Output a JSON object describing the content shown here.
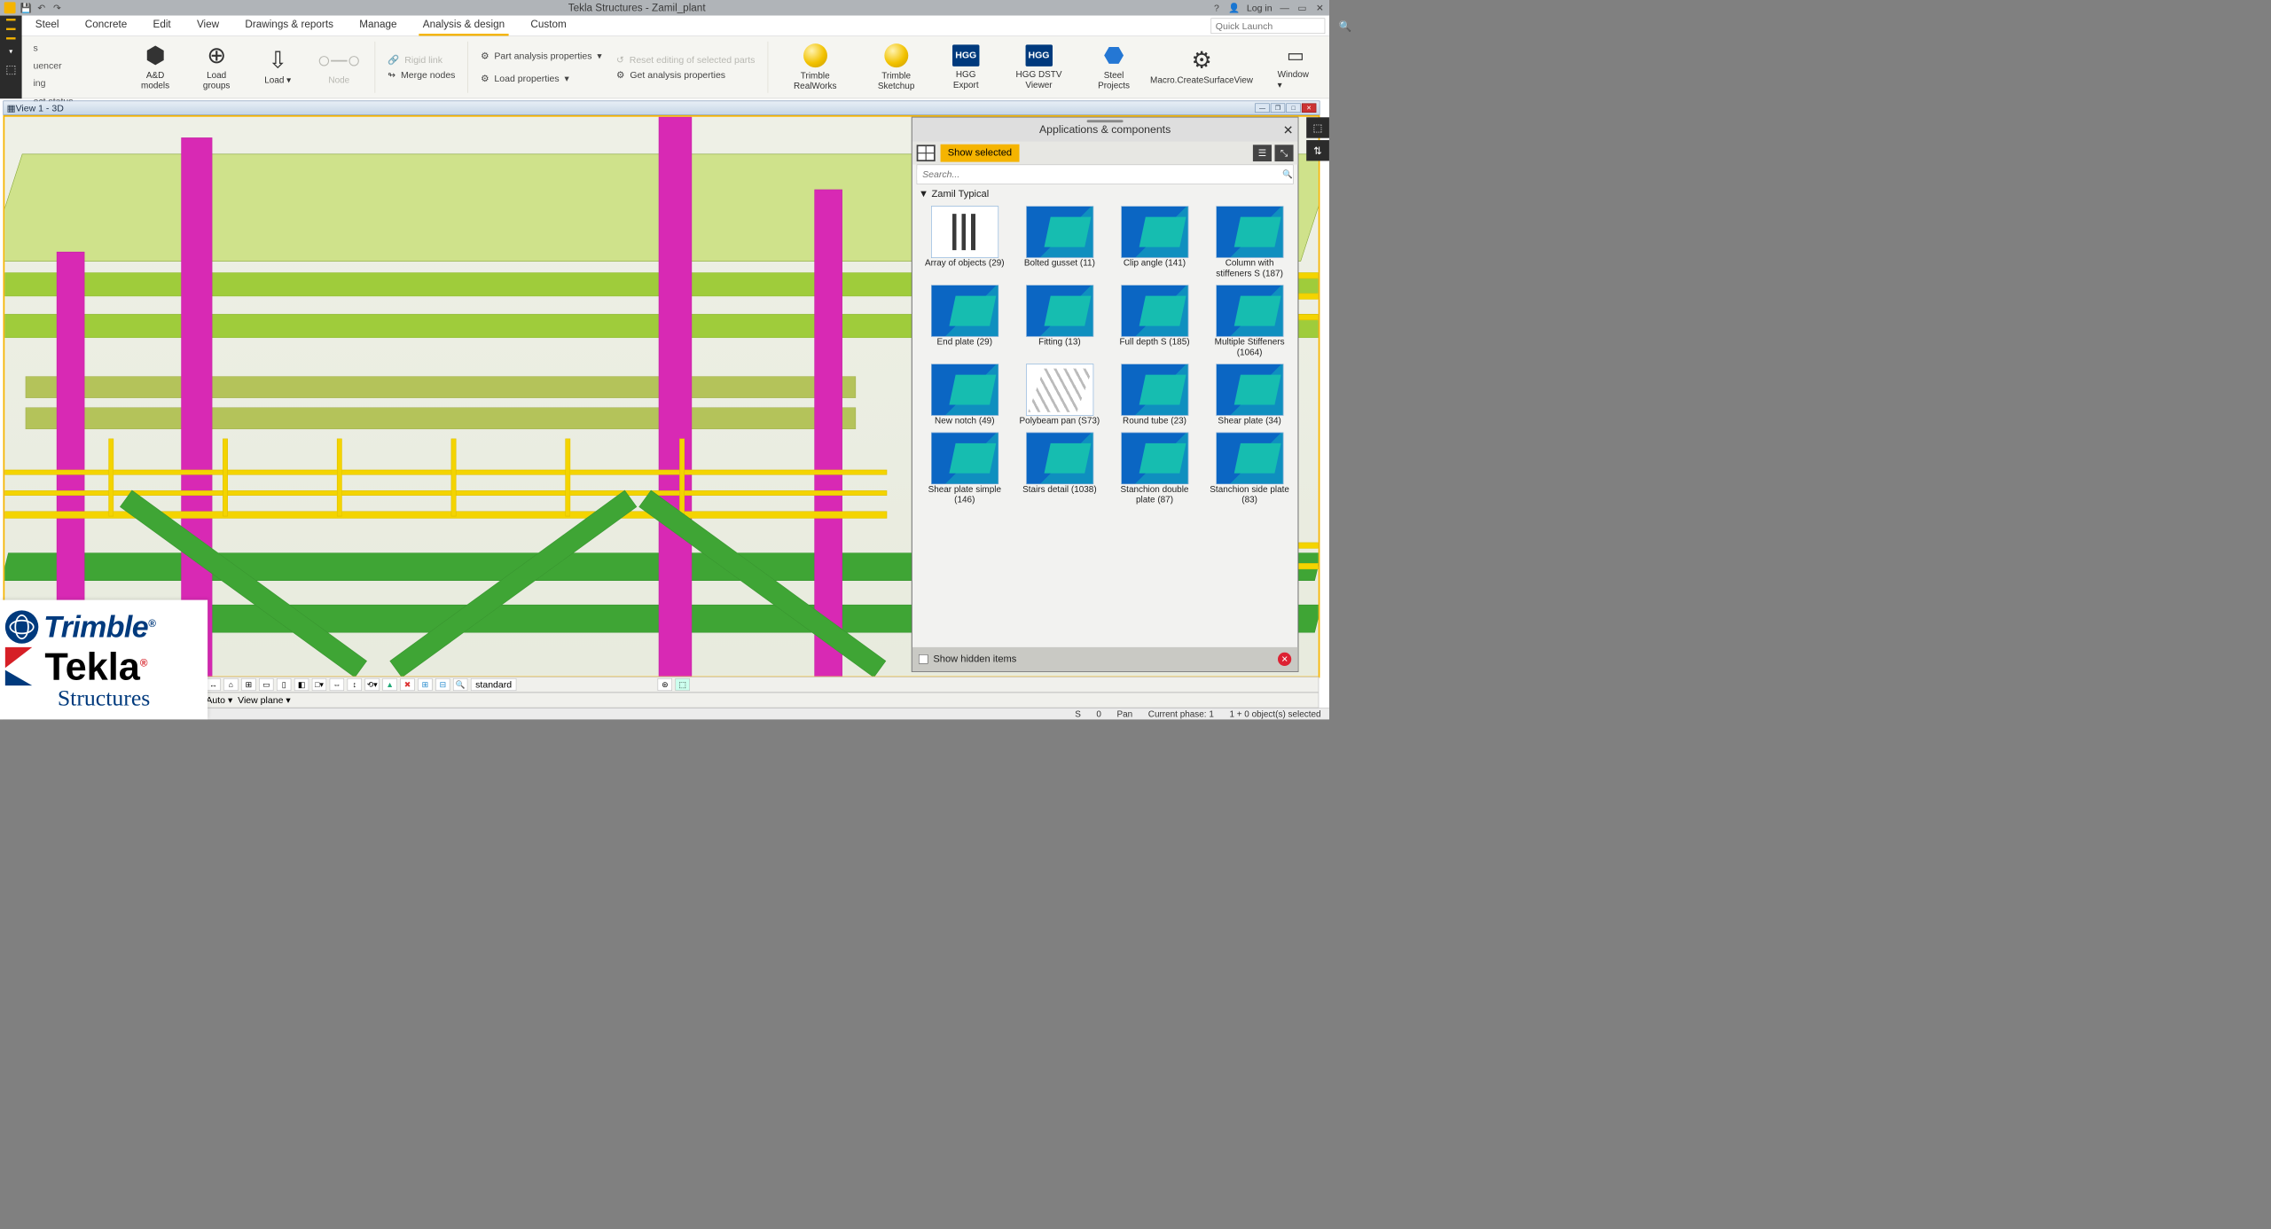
{
  "title": "Tekla Structures - Zamil_plant",
  "titlebar": {
    "login": "Log in"
  },
  "menu": {
    "tabs": [
      "Steel",
      "Concrete",
      "Edit",
      "View",
      "Drawings & reports",
      "Manage",
      "Analysis & design",
      "Custom"
    ],
    "active_index": 6,
    "quick_launch_placeholder": "Quick Launch"
  },
  "leftfrag": {
    "l0": "s",
    "l1": "uencer",
    "l2": "ing",
    "l3": "ect status"
  },
  "ribbon": {
    "ad_models": "A&D models",
    "load_groups": "Load groups",
    "load": "Load",
    "node": "Node",
    "rigid_link": "Rigid link",
    "merge_nodes": "Merge nodes",
    "part_analysis": "Part analysis properties",
    "reset_editing": "Reset editing of selected parts",
    "load_properties": "Load properties",
    "get_analysis": "Get analysis properties",
    "trimble_realworks": "Trimble RealWorks",
    "trimble_sketchup": "Trimble Sketchup",
    "hgg_export": "HGG Export",
    "hgg_dstv": "HGG DSTV Viewer",
    "steel_projects": "Steel Projects",
    "macro_surface": "Macro.CreateSurfaceView",
    "window": "Window"
  },
  "view": {
    "tab_label": "View 1 - 3D"
  },
  "apps": {
    "title": "Applications & components",
    "show_selected": "Show selected",
    "search_placeholder": "Search...",
    "group": "Zamil Typical",
    "items": [
      {
        "label": "Array of objects (29)"
      },
      {
        "label": "Bolted gusset (11)"
      },
      {
        "label": "Clip angle (141)"
      },
      {
        "label": "Column with stiffeners S (187)"
      },
      {
        "label": "End plate (29)"
      },
      {
        "label": "Fitting (13)"
      },
      {
        "label": "Full depth S (185)"
      },
      {
        "label": "Multiple Stiffeners (1064)"
      },
      {
        "label": "New notch (49)"
      },
      {
        "label": "Polybeam pan (S73)"
      },
      {
        "label": "Round tube (23)"
      },
      {
        "label": "Shear plate (34)"
      },
      {
        "label": "Shear plate simple (146)"
      },
      {
        "label": "Stairs detail (1038)"
      },
      {
        "label": "Stanchion double plate (87)"
      },
      {
        "label": "Stanchion side plate (83)"
      }
    ],
    "show_hidden": "Show hidden items"
  },
  "bottom": {
    "render_field": "standard",
    "auto": "Auto",
    "view_plane": "View plane"
  },
  "status": {
    "s": "S",
    "zero": "0",
    "pan": "Pan",
    "phase": "Current phase: 1",
    "sel": "1 + 0 object(s) selected"
  },
  "logo": {
    "trimble": "Trimble",
    "tekla": "Tekla",
    "structures": "Structures"
  }
}
